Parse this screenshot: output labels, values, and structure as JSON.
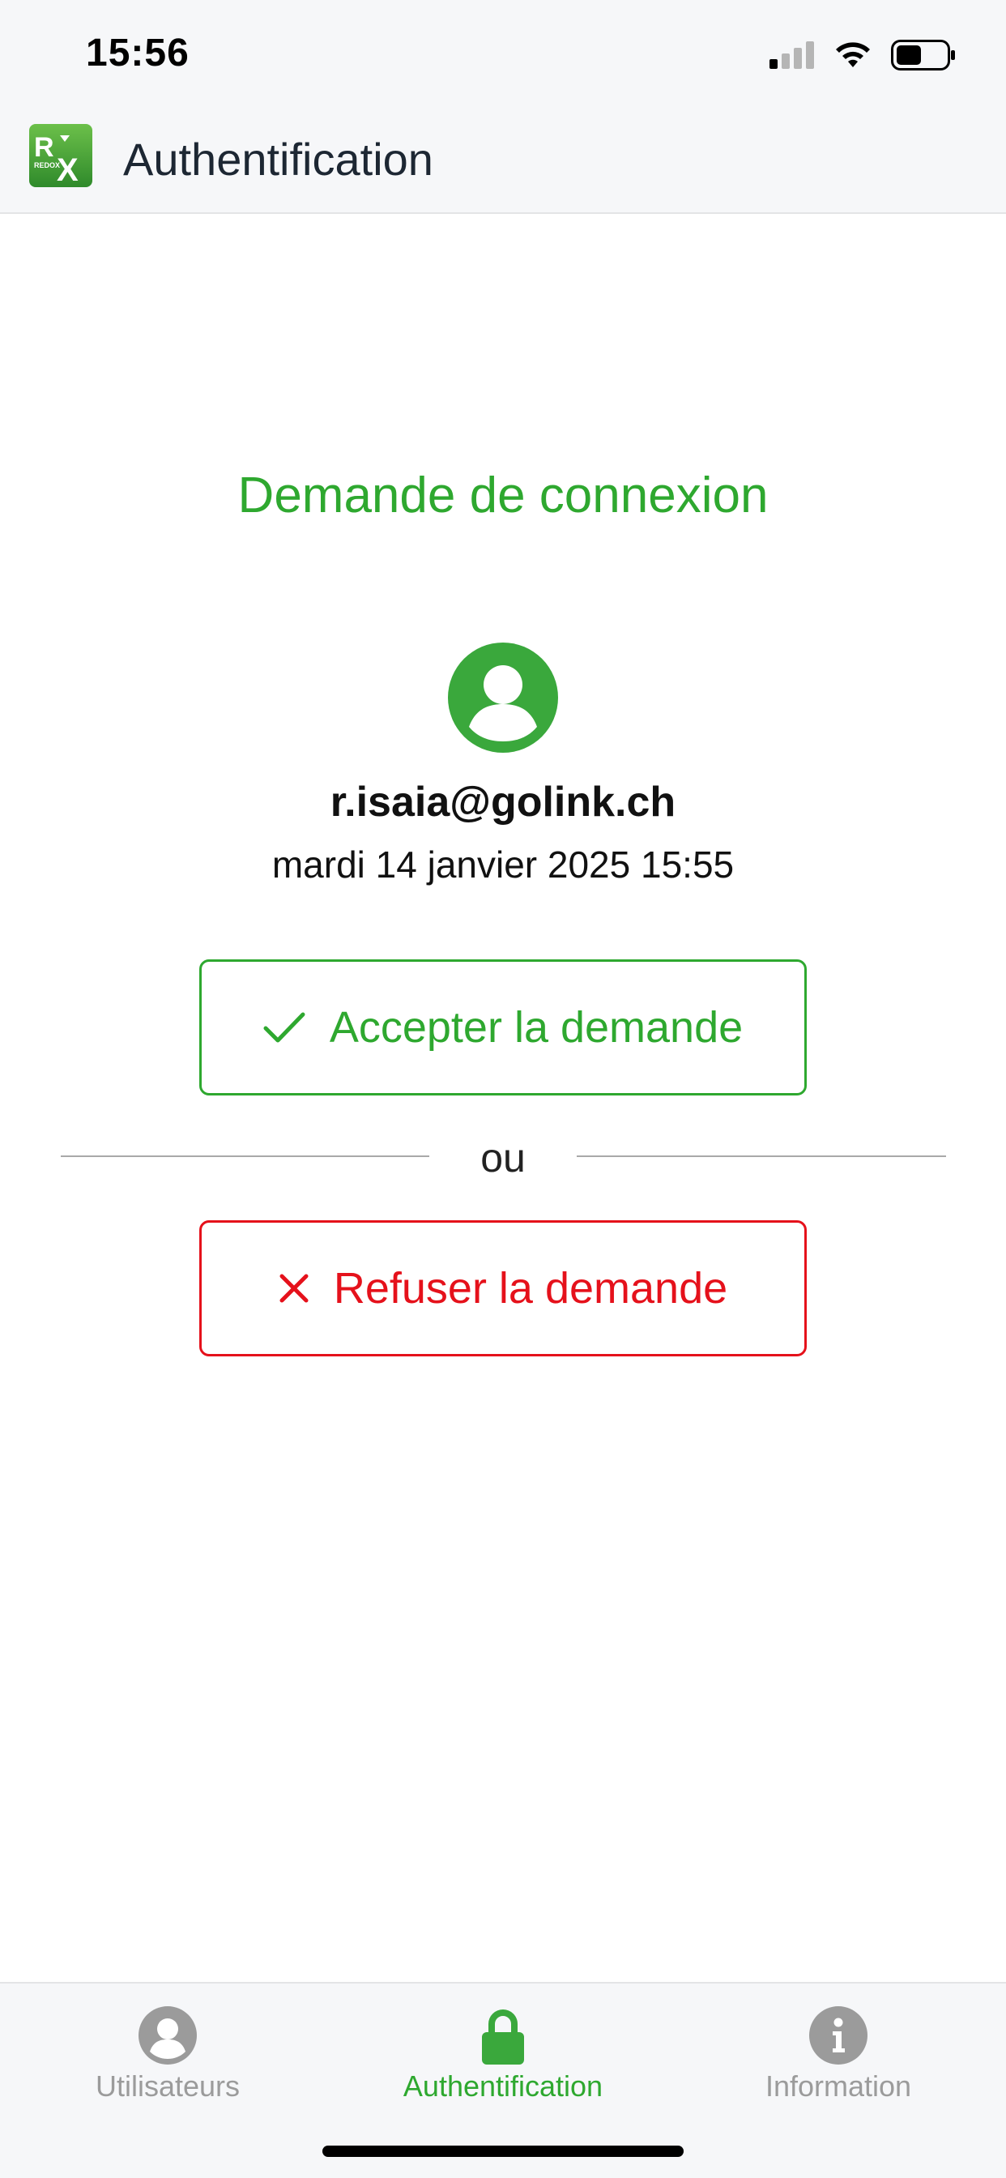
{
  "status_bar": {
    "time": "15:56",
    "icons": [
      "signal-icon",
      "wifi-icon",
      "battery-icon"
    ]
  },
  "header": {
    "logo_icon": "redox-logo-icon",
    "logo_text": "RX REDOX",
    "title": "Authentification"
  },
  "request": {
    "title": "Demande de connexion",
    "avatar_icon": "user-avatar-icon",
    "email": "r.isaia@golink.ch",
    "date": "mardi 14 janvier 2025 15:55",
    "accept_label": "Accepter la demande",
    "accept_icon": "checkmark-icon",
    "separator": "ou",
    "refuse_label": "Refuser la demande",
    "refuse_icon": "close-icon"
  },
  "tabs": [
    {
      "label": "Utilisateurs",
      "icon": "user-icon",
      "active": false
    },
    {
      "label": "Authentification",
      "icon": "lock-icon",
      "active": true
    },
    {
      "label": "Information",
      "icon": "info-icon",
      "active": false
    }
  ],
  "colors": {
    "accent_green": "#2ea82f",
    "danger_red": "#e5111b",
    "inactive_gray": "#9b9b9b",
    "bar_background": "#f6f7f9"
  }
}
